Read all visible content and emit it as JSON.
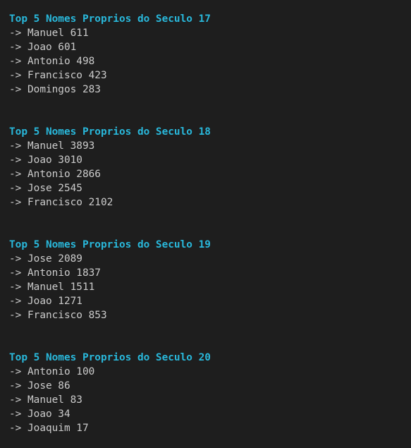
{
  "colors": {
    "background": "#1e1e1e",
    "heading": "#29b8db",
    "text": "#cccccc"
  },
  "sections": [
    {
      "heading": "Top 5 Nomes Proprios do Seculo 17",
      "entries": [
        "-> Manuel 611",
        "-> Joao 601",
        "-> Antonio 498",
        "-> Francisco 423",
        "-> Domingos 283"
      ]
    },
    {
      "heading": "Top 5 Nomes Proprios do Seculo 18",
      "entries": [
        "-> Manuel 3893",
        "-> Joao 3010",
        "-> Antonio 2866",
        "-> Jose 2545",
        "-> Francisco 2102"
      ]
    },
    {
      "heading": "Top 5 Nomes Proprios do Seculo 19",
      "entries": [
        "-> Jose 2089",
        "-> Antonio 1837",
        "-> Manuel 1511",
        "-> Joao 1271",
        "-> Francisco 853"
      ]
    },
    {
      "heading": "Top 5 Nomes Proprios do Seculo 20",
      "entries": [
        "-> Antonio 100",
        "-> Jose 86",
        "-> Manuel 83",
        "-> Joao 34",
        "-> Joaquim 17"
      ]
    }
  ]
}
